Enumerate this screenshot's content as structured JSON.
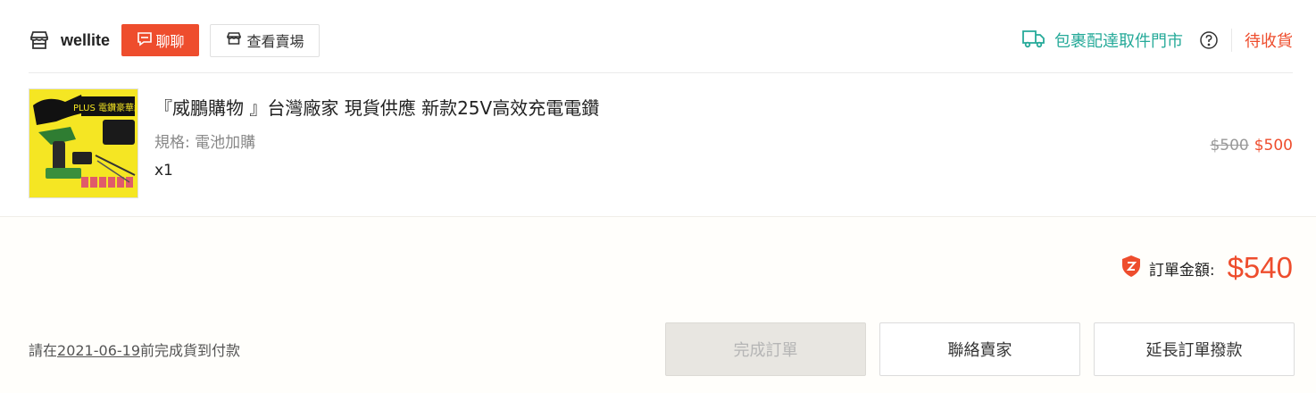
{
  "shop": {
    "name": "wellite",
    "chat_label": "聊聊",
    "view_shop_label": "查看賣場"
  },
  "delivery": {
    "text": "包裹配達取件門市"
  },
  "order": {
    "status": "待收貨",
    "total_label": "訂單金額:",
    "total_amount": "$540",
    "deadline_prefix": "請在",
    "deadline_date": "2021-06-19",
    "deadline_suffix": "前完成貨到付款"
  },
  "product": {
    "title": "『威鵬購物 』台灣廠家 現貨供應 新款25V高效充電電鑽",
    "spec": "規格: 電池加購",
    "qty": "x1",
    "original_price": "$500",
    "price": "$500",
    "image_text": "PLUS 電鑽豪華組"
  },
  "buttons": {
    "complete": "完成訂單",
    "contact": "聯絡賣家",
    "extend": "延長訂單撥款"
  },
  "colors": {
    "accent": "#ee4d2d",
    "delivery": "#26aa99",
    "thumb_bg": "#f5e623"
  },
  "icons": [
    "shop-icon",
    "chat-icon",
    "store-icon",
    "truck-icon",
    "help-icon",
    "shield-icon"
  ]
}
